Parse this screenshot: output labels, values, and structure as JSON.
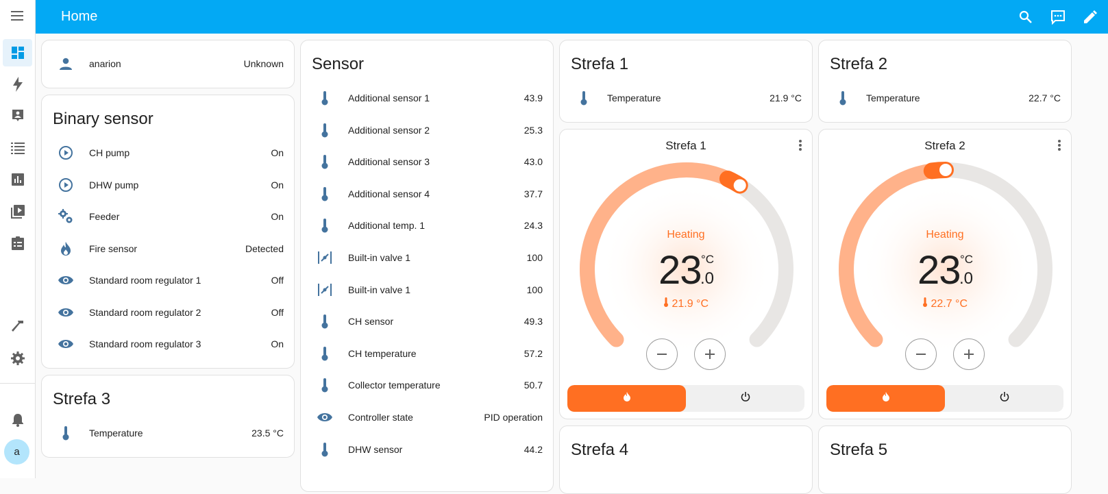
{
  "header": {
    "title": "Home"
  },
  "sidebar": {
    "items": [
      {
        "icon": "menu-icon"
      },
      {
        "icon": "dashboard-icon",
        "active": true
      },
      {
        "icon": "energy-icon"
      },
      {
        "icon": "logbook-icon"
      },
      {
        "icon": "todo-list-icon"
      },
      {
        "icon": "history-icon"
      },
      {
        "icon": "media-icon"
      },
      {
        "icon": "clipboard-icon"
      },
      {
        "icon": "developer-tools-icon"
      },
      {
        "icon": "settings-icon"
      },
      {
        "icon": "notifications-icon"
      }
    ],
    "avatar": "a"
  },
  "person_card": {
    "name": "anarion",
    "state": "Unknown"
  },
  "binary_card": {
    "title": "Binary sensor",
    "rows": [
      {
        "label": "CH pump",
        "value": "On",
        "icon": "play-circle-icon"
      },
      {
        "label": "DHW pump",
        "value": "On",
        "icon": "play-circle-icon"
      },
      {
        "label": "Feeder",
        "value": "On",
        "icon": "cogs-icon"
      },
      {
        "label": "Fire sensor",
        "value": "Detected",
        "icon": "fire-icon"
      },
      {
        "label": "Standard room regulator 1",
        "value": "Off",
        "icon": "eye-icon"
      },
      {
        "label": "Standard room regulator 2",
        "value": "Off",
        "icon": "eye-icon"
      },
      {
        "label": "Standard room regulator 3",
        "value": "On",
        "icon": "eye-icon"
      }
    ]
  },
  "strefa3": {
    "title": "Strefa 3",
    "label": "Temperature",
    "value": "23.5 °C"
  },
  "sensor_card": {
    "title": "Sensor",
    "rows": [
      {
        "label": "Additional sensor 1",
        "value": "43.9",
        "icon": "thermometer-icon"
      },
      {
        "label": "Additional sensor 2",
        "value": "25.3",
        "icon": "thermometer-icon"
      },
      {
        "label": "Additional sensor 3",
        "value": "43.0",
        "icon": "thermometer-icon"
      },
      {
        "label": "Additional sensor 4",
        "value": "37.7",
        "icon": "thermometer-icon"
      },
      {
        "label": "Additional temp. 1",
        "value": "24.3",
        "icon": "thermometer-icon"
      },
      {
        "label": "Built-in valve 1",
        "value": "100",
        "icon": "valve-icon"
      },
      {
        "label": "Built-in valve 1",
        "value": "100",
        "icon": "valve-icon"
      },
      {
        "label": "CH sensor",
        "value": "49.3",
        "icon": "thermometer-icon"
      },
      {
        "label": "CH temperature",
        "value": "57.2",
        "icon": "thermometer-icon"
      },
      {
        "label": "Collector temperature",
        "value": "50.7",
        "icon": "thermometer-icon"
      },
      {
        "label": "Controller state",
        "value": "PID operation",
        "icon": "eye-icon"
      },
      {
        "label": "DHW sensor",
        "value": "44.2",
        "icon": "thermometer-icon"
      }
    ]
  },
  "strefa1": {
    "title": "Strefa 1",
    "label": "Temperature",
    "value": "21.9 °C"
  },
  "strefa2": {
    "title": "Strefa 2",
    "label": "Temperature",
    "value": "22.7 °C"
  },
  "thermo1": {
    "title": "Strefa 1",
    "mode": "Heating",
    "target_int": "23",
    "unit": "°C",
    "target_dec": ".0",
    "current": "21.9 °C",
    "level": 0.62
  },
  "thermo2": {
    "title": "Strefa 2",
    "mode": "Heating",
    "target_int": "23",
    "unit": "°C",
    "target_dec": ".0",
    "current": "22.7 °C",
    "level": 0.5
  },
  "strefa4": {
    "title": "Strefa 4"
  },
  "strefa5": {
    "title": "Strefa 5"
  },
  "colors": {
    "accent": "#03a9f4",
    "heat": "#ff6f22",
    "icon": "#44739e"
  }
}
